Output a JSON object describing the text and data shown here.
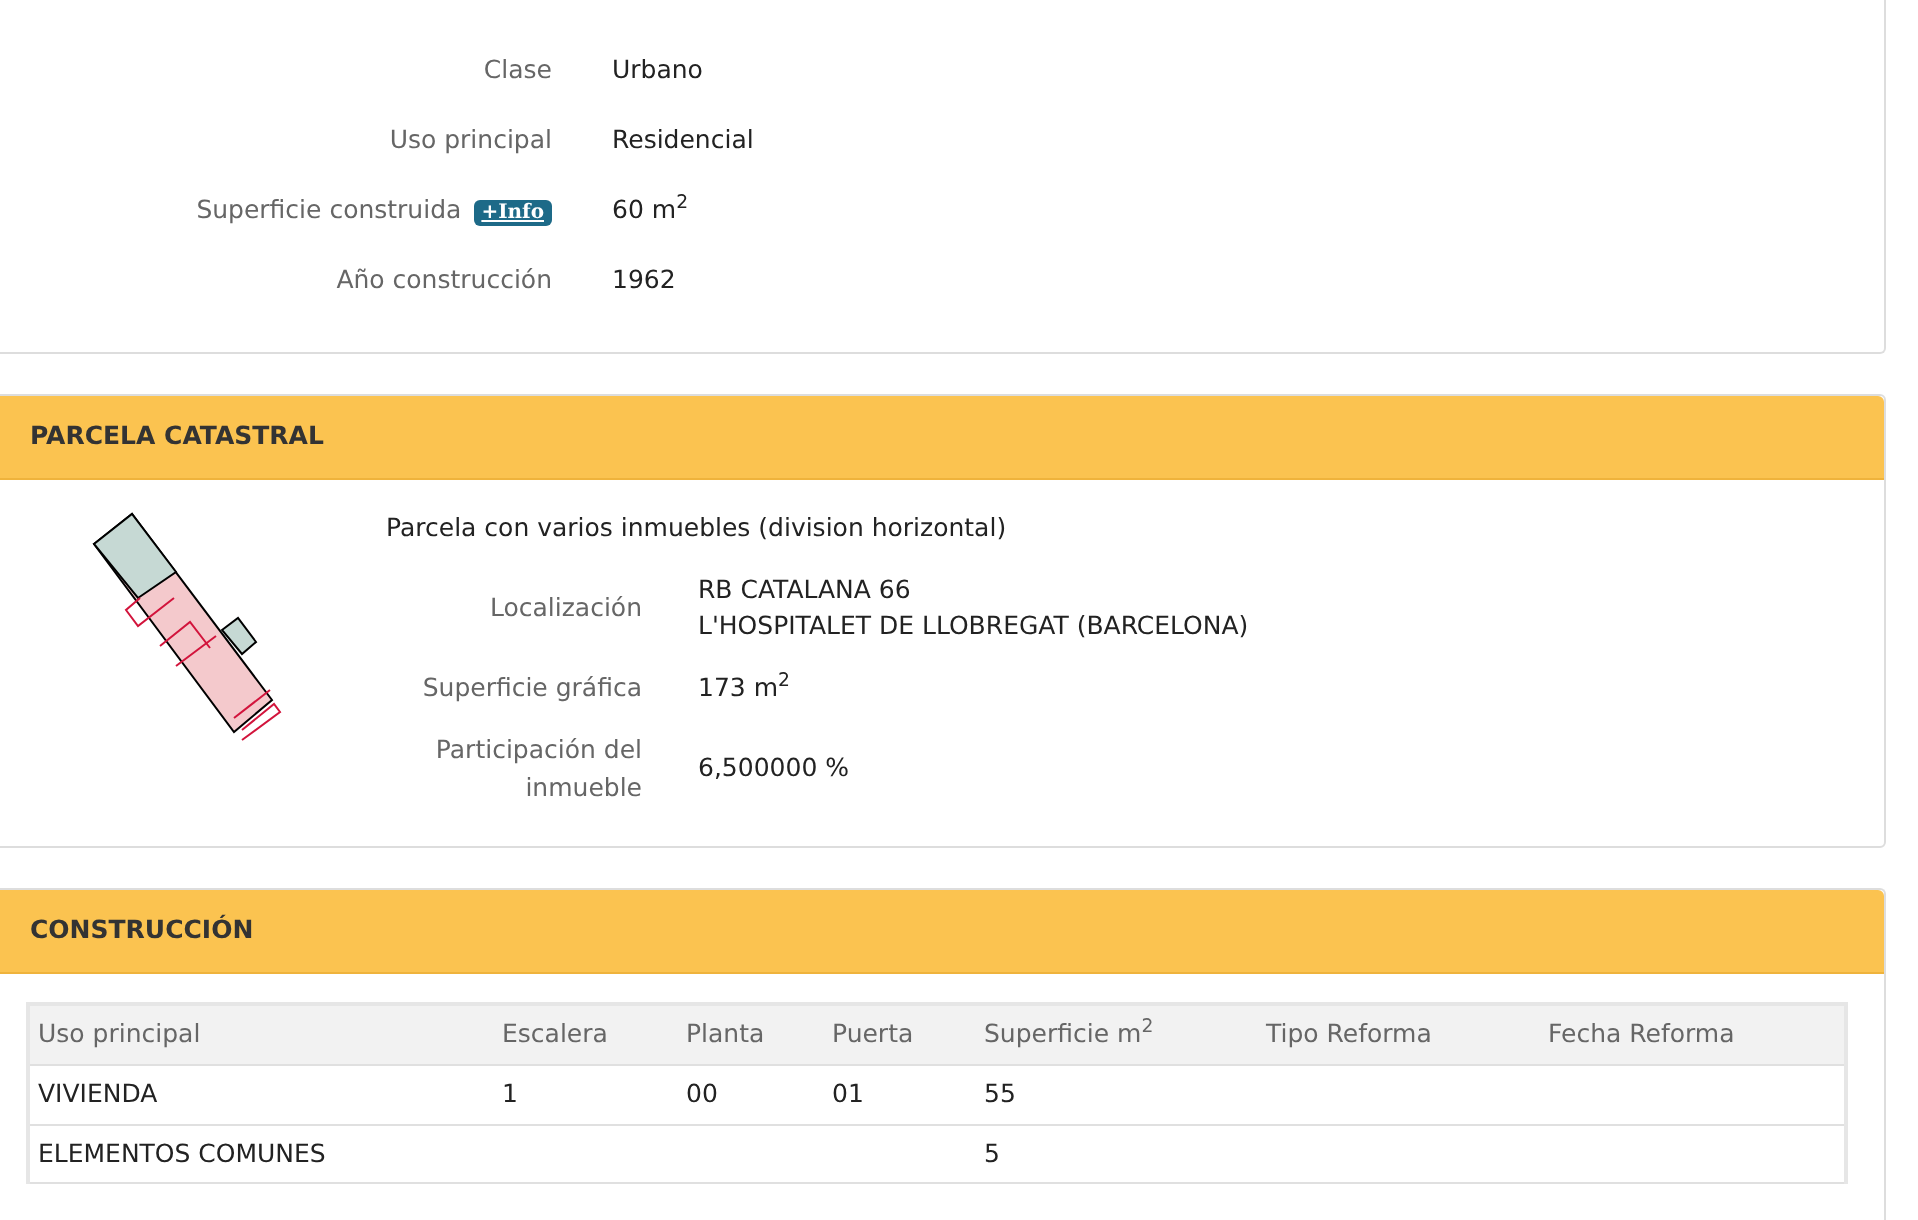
{
  "inmueble": {
    "fields": [
      {
        "label": "Clase",
        "value": "Urbano"
      },
      {
        "label": "Uso principal",
        "value": "Residencial"
      },
      {
        "label": "Superficie construida",
        "badge": "+Info",
        "value": "60 m$^{2}$"
      },
      {
        "label": "Año construcción",
        "value": "1962"
      }
    ]
  },
  "parcela": {
    "title": "PARCELA CATASTRAL",
    "note": "Parcela con varios inmuebles (division horizontal)",
    "fields": [
      {
        "label": "Localización",
        "lines": [
          "RB CATALANA 66",
          "L'HOSPITALET DE LLOBREGAT (BARCELONA)"
        ]
      },
      {
        "label": "Superficie gráfica",
        "lines": [
          "173 m$^{2}$"
        ]
      },
      {
        "label": "Participación del inmueble",
        "lines": [
          "6,500000 %"
        ]
      }
    ]
  },
  "construccion": {
    "title": "CONSTRUCCIÓN",
    "table": {
      "columns": [
        "Uso principal",
        "Escalera",
        "Planta",
        "Puerta",
        "Superficie m$^{2}$",
        "Tipo Reforma",
        "Fecha Reforma"
      ],
      "rows": [
        [
          "VIVIENDA",
          "1",
          "00",
          "01",
          "55",
          "",
          ""
        ],
        [
          "ELEMENTOS COMUNES",
          "",
          "",
          "",
          "5",
          "",
          ""
        ]
      ]
    }
  }
}
